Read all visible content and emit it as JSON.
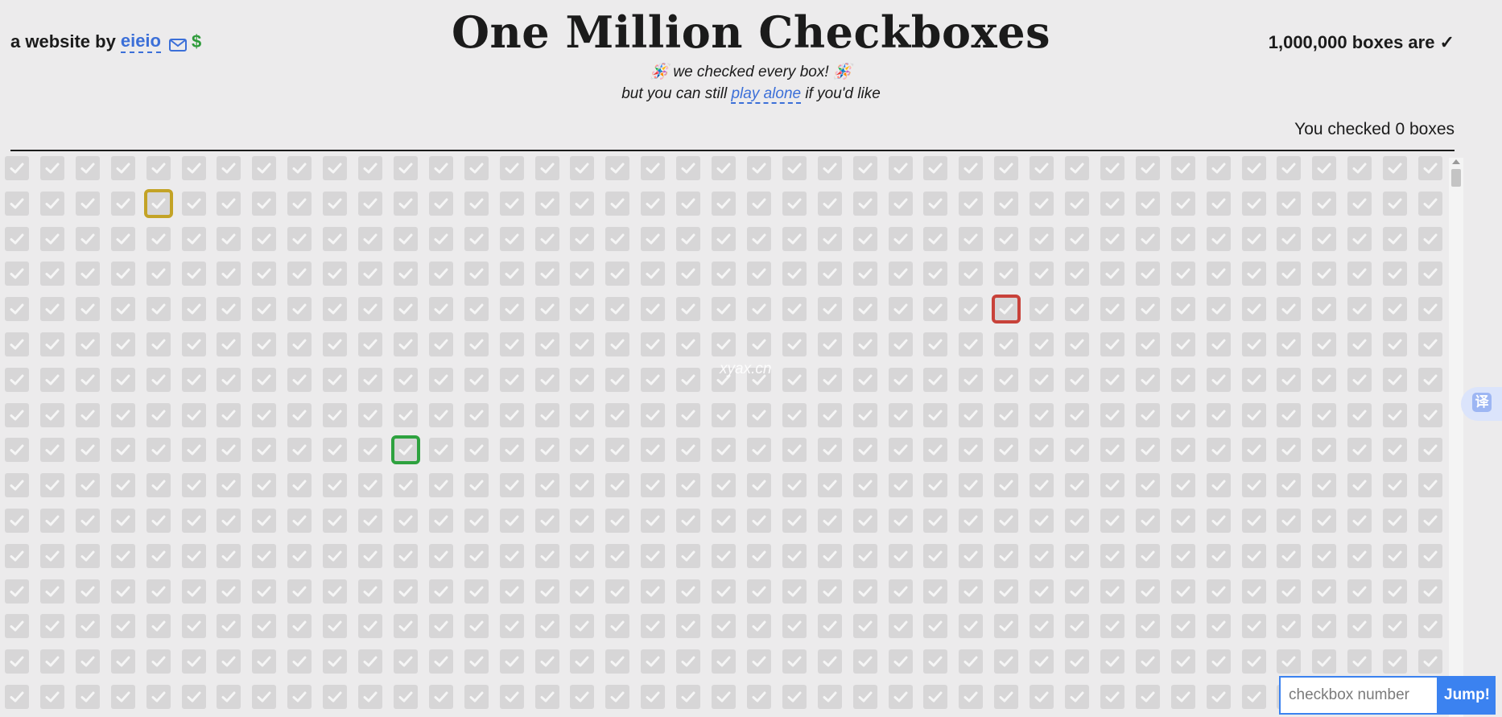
{
  "header": {
    "byline_prefix": "a website by",
    "author_link": "eieio",
    "mail_icon": "mail-icon",
    "dollar_icon": "$",
    "title": "One Million Checkboxes",
    "subtitle_line1": "🪅 we checked every box! 🪅",
    "subtitle_line2_before": "but you can still ",
    "subtitle_line2_link": "play alone",
    "subtitle_line2_after": " if you'd like",
    "total_status": "1,000,000 boxes are ✓",
    "user_checked": "You checked 0 boxes"
  },
  "grid": {
    "box_state": "checked",
    "highlighted": [
      {
        "row": 2,
        "col": 5,
        "color": "yellow"
      },
      {
        "row": 5,
        "col": 29,
        "color": "red"
      },
      {
        "row": 9,
        "col": 12,
        "color": "green"
      }
    ]
  },
  "watermark": "xyax.cn",
  "translate_button": "译",
  "jump": {
    "placeholder": "checkbox number",
    "button_label": "Jump!"
  },
  "colors": {
    "background": "#ecebec",
    "link": "#3b6fd8",
    "accent_button": "#3b82f0",
    "highlight_yellow": "#c3a326",
    "highlight_red": "#c8423a",
    "highlight_green": "#2ea23f",
    "dollar": "#2e9b3a"
  }
}
